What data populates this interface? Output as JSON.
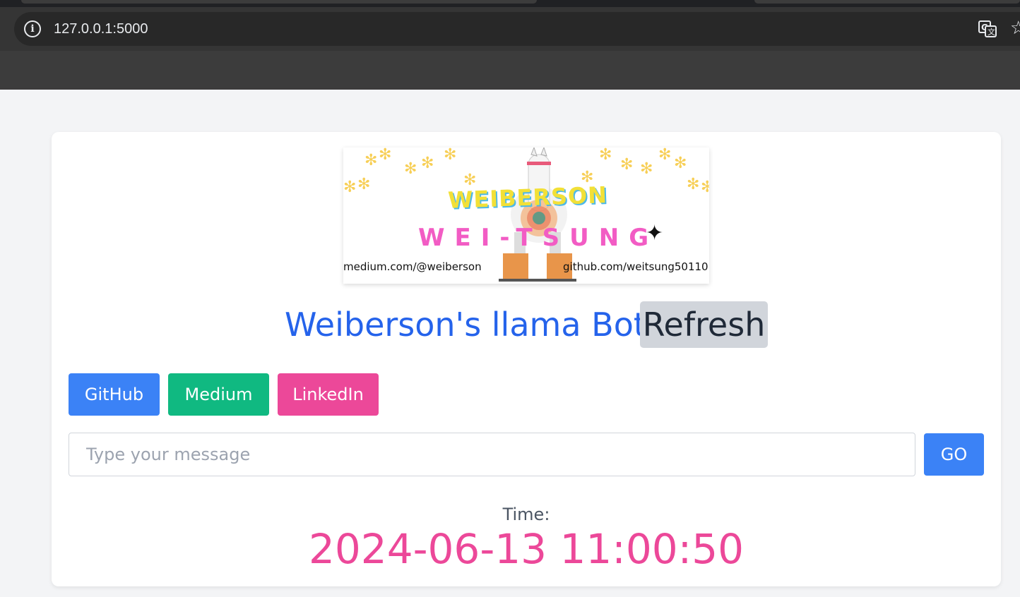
{
  "browser": {
    "url": "127.0.0.1:5000",
    "icons": [
      "info-icon",
      "translate-icon",
      "bookmark-star-icon"
    ]
  },
  "banner": {
    "title": "WEIBERSON",
    "subtitle": "WEI-TSUNG",
    "medium_link": "medium.com/@weiberson",
    "github_link": "github.com/weitsung50110"
  },
  "header": {
    "title": "Weiberson's llama Bot",
    "refresh_label": "Refresh"
  },
  "links": {
    "github_label": "GitHub",
    "medium_label": "Medium",
    "linkedin_label": "LinkedIn"
  },
  "chat": {
    "input_value": "",
    "input_placeholder": "Type your message",
    "go_label": "GO"
  },
  "time": {
    "label": "Time:",
    "value": "2024-06-13 11:00:50"
  },
  "colors": {
    "title": "#2563eb",
    "github": "#3b82f6",
    "medium": "#10b981",
    "linkedin": "#ec4899",
    "time_value": "#ec4899",
    "refresh_bg": "#d1d5db"
  }
}
